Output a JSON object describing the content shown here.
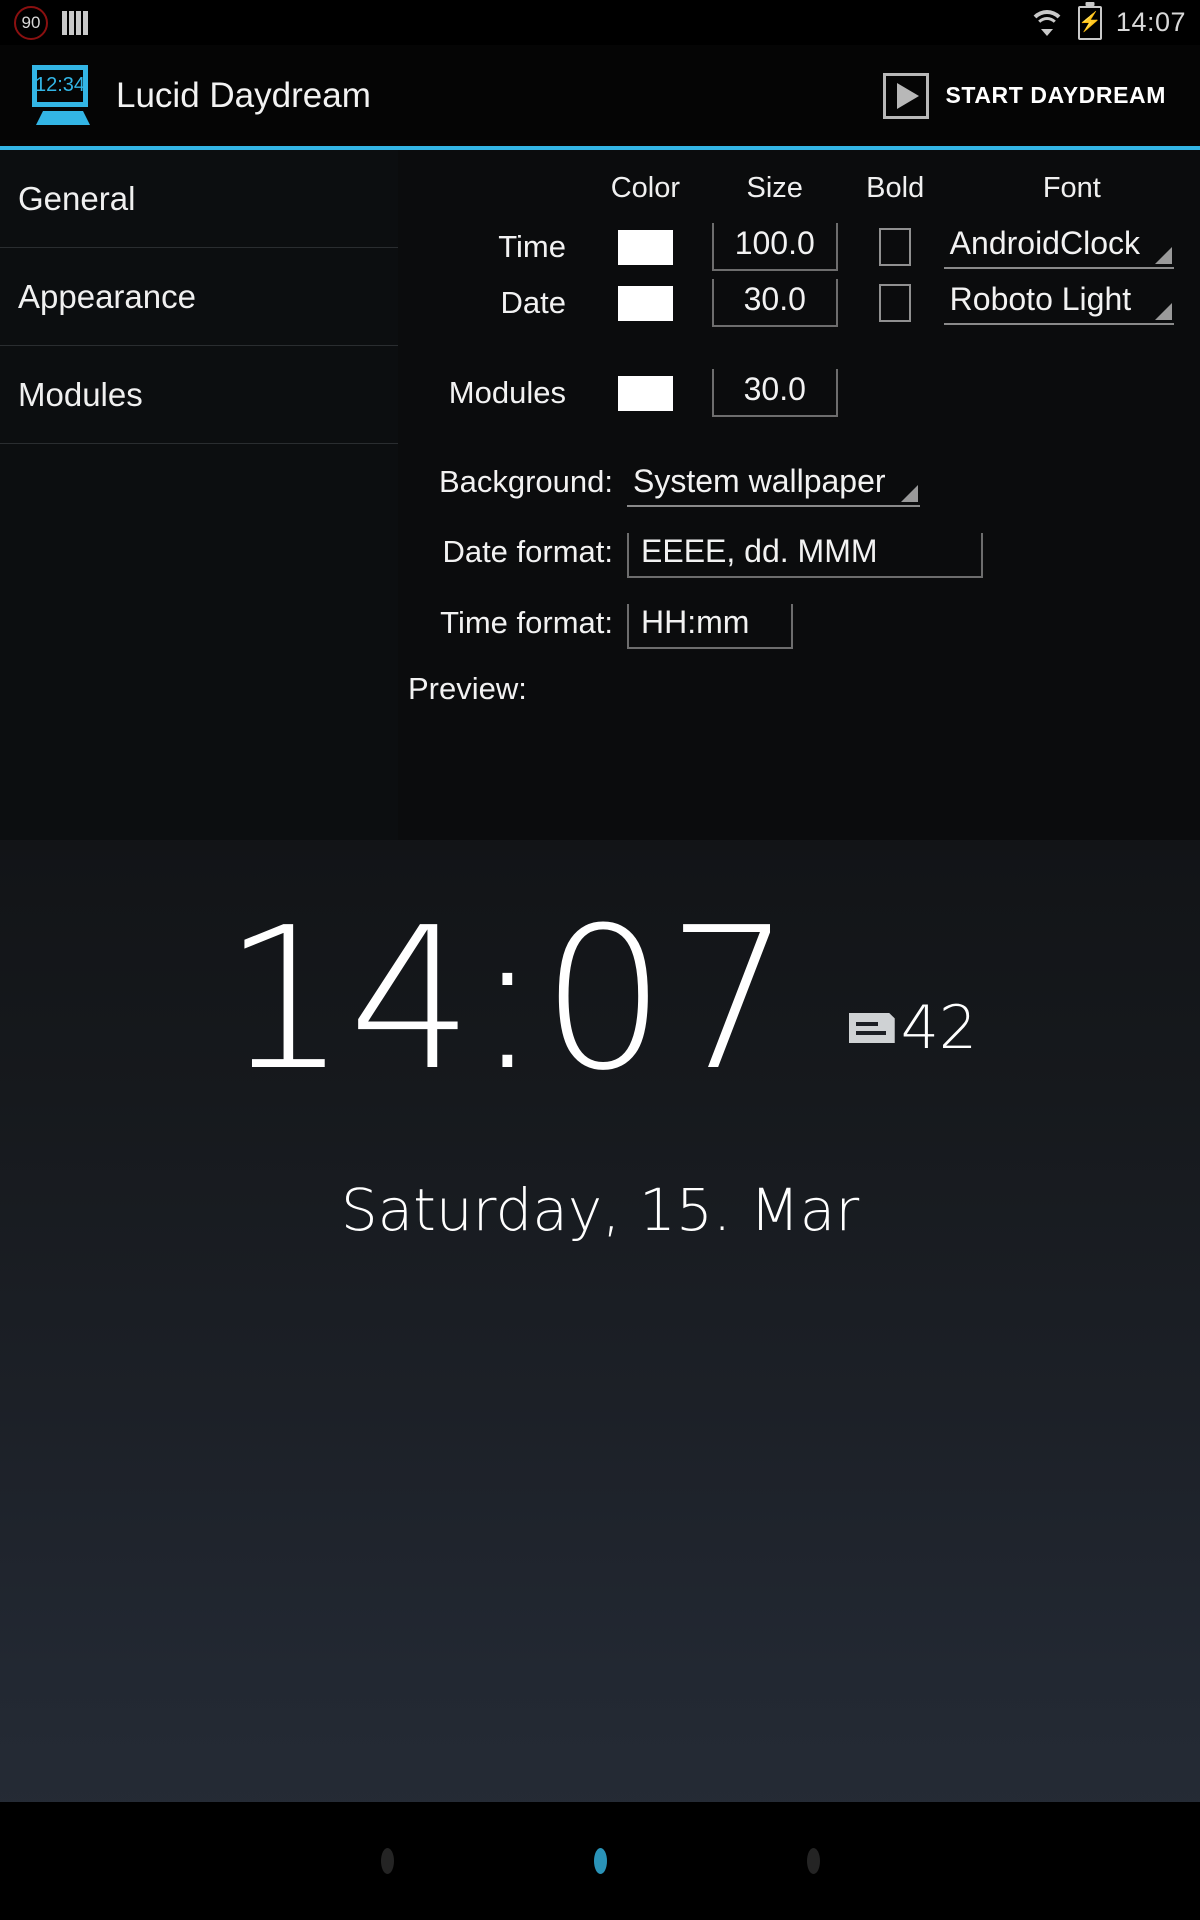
{
  "statusbar": {
    "speed_badge": "90",
    "bars_icon": "signal-bars-icon",
    "wifi_icon": "wifi-icon",
    "battery_icon": "battery-charging-icon",
    "clock": "14:07"
  },
  "actionbar": {
    "app_icon_time": "12:34",
    "title": "Lucid Daydream",
    "start_label": "START DAYDREAM"
  },
  "sidebar": {
    "items": [
      {
        "label": "General"
      },
      {
        "label": "Appearance"
      },
      {
        "label": "Modules"
      }
    ]
  },
  "settings": {
    "columns": {
      "color": "Color",
      "size": "Size",
      "bold": "Bold",
      "font": "Font"
    },
    "rows": [
      {
        "label": "Time",
        "color": "#ffffff",
        "size": "100.0",
        "bold": false,
        "font": "AndroidClock"
      },
      {
        "label": "Date",
        "color": "#ffffff",
        "size": "30.0",
        "bold": false,
        "font": "Roboto Light"
      },
      {
        "label": "Modules",
        "color": "#ffffff",
        "size": "30.0"
      }
    ],
    "background": {
      "label": "Background:",
      "value": "System wallpaper"
    },
    "date_format": {
      "label": "Date format:",
      "value": "EEEE, dd. MMM"
    },
    "time_format": {
      "label": "Time format:",
      "value": "HH:mm"
    },
    "preview_label": "Preview:"
  },
  "preview": {
    "time": "14:07",
    "module_icon": "message-icon",
    "module_count": "42",
    "date": "Saturday, 15. Mar"
  },
  "navbar": {
    "back": "back-dot",
    "home": "home-dot",
    "recents": "recents-dot"
  },
  "colors": {
    "accent": "#33b5e5",
    "swatch": "#ffffff",
    "nav_active": "#2a93b8"
  }
}
